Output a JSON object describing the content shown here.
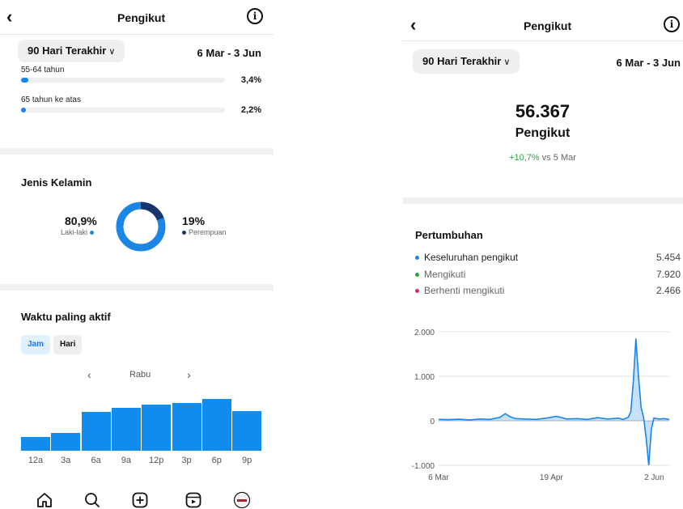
{
  "left": {
    "header": {
      "back_icon": "chevron-left-icon",
      "title": "Pengikut",
      "info_icon": "info-icon"
    },
    "range": {
      "button_label": "90 Hari Terakhir",
      "dates": "6 Mar - 3 Jun"
    },
    "age": {
      "rows": [
        {
          "label": "55-64 tahun",
          "value": "3,4%",
          "fraction": 0.034
        },
        {
          "label": "65 tahun ke atas",
          "value": "2,2%",
          "fraction": 0.022
        }
      ]
    },
    "gender": {
      "title": "Jenis Kelamin",
      "male_pct": "80,9%",
      "male_label": "Laki-laki",
      "male_fraction": 0.809,
      "female_pct": "19%",
      "female_label": "Perempuan",
      "female_fraction": 0.19,
      "male_color": "#1b86e6",
      "female_color": "#16356b"
    },
    "active": {
      "title": "Waktu paling aktif",
      "tabs": [
        "Jam",
        "Hari"
      ],
      "active_tab": "Jam",
      "day": "Rabu",
      "prev_icon": "chevron-left-icon",
      "next_icon": "chevron-right-icon",
      "hours": [
        "12a",
        "3a",
        "6a",
        "9a",
        "12p",
        "3p",
        "6p",
        "9p"
      ],
      "values": [
        17,
        21,
        47,
        52,
        55,
        57,
        62,
        48
      ]
    },
    "bottom_nav": [
      "home-icon",
      "search-icon",
      "create-icon",
      "reels-icon",
      "profile-icon"
    ]
  },
  "right": {
    "header": {
      "back_icon": "chevron-left-icon",
      "title": "Pengikut",
      "info_icon": "info-icon"
    },
    "range": {
      "button_label": "90 Hari Terakhir",
      "dates": "6 Mar - 3 Jun"
    },
    "summary": {
      "count": "56.367",
      "label": "Pengikut",
      "delta": "+10,7%",
      "delta_suffix": " vs 5 Mar"
    },
    "growth": {
      "title": "Pertumbuhan",
      "rows": [
        {
          "label": "Keseluruhan pengikut",
          "value": "5.454",
          "color": "#1b86e6"
        },
        {
          "label": "Mengikuti",
          "value": "7.920",
          "color": "#2ea043"
        },
        {
          "label": "Berhenti mengikuti",
          "value": "2.466",
          "color": "#e0245e"
        }
      ]
    }
  },
  "chart_data": {
    "type": "area",
    "title": "",
    "xlabel": "",
    "ylabel": "",
    "ylim": [
      -1000,
      2000
    ],
    "y_ticks": [
      "2.000",
      "1.000",
      "0",
      "-1.000"
    ],
    "y_tick_values": [
      2000,
      1000,
      0,
      -1000
    ],
    "x_ticks": [
      "6 Mar",
      "19 Apr",
      "2 Jun"
    ],
    "x_tick_positions": [
      0,
      44,
      88
    ],
    "x_range": [
      0,
      90
    ],
    "grid": true,
    "color": "#1b86e6",
    "series": [
      {
        "x": [
          0,
          4,
          8,
          12,
          16,
          20,
          24,
          26,
          28,
          30,
          34,
          38,
          42,
          46,
          50,
          54,
          58,
          62,
          66,
          70,
          72,
          74,
          75,
          76,
          77,
          78,
          79,
          80,
          81,
          82,
          83,
          84,
          86,
          88,
          90
        ],
        "values": [
          30,
          25,
          35,
          20,
          40,
          30,
          80,
          160,
          90,
          50,
          40,
          30,
          60,
          100,
          40,
          50,
          30,
          70,
          40,
          60,
          30,
          80,
          200,
          900,
          1850,
          1000,
          300,
          80,
          -400,
          -1000,
          -200,
          60,
          40,
          50,
          30
        ]
      }
    ]
  }
}
